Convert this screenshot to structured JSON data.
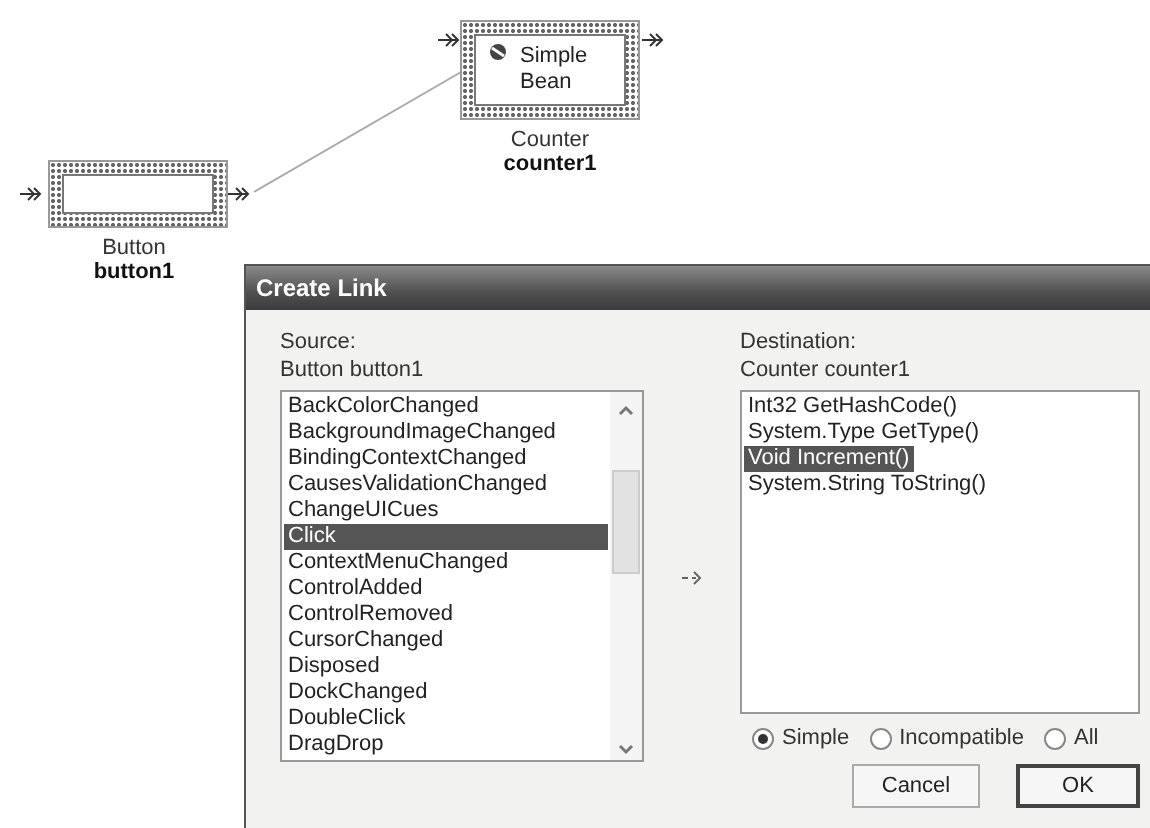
{
  "diagram": {
    "nodes": [
      {
        "kind": "bean",
        "body": "Simple Bean",
        "type_label": "Counter",
        "name": "counter1"
      },
      {
        "kind": "control",
        "type_label": "Button",
        "name": "button1"
      }
    ]
  },
  "dialog": {
    "title": "Create Link",
    "source": {
      "label": "Source:",
      "object": "Button button1",
      "items": [
        {
          "label": "BackColorChanged",
          "selected": false
        },
        {
          "label": "BackgroundImageChanged",
          "selected": false
        },
        {
          "label": "BindingContextChanged",
          "selected": false
        },
        {
          "label": "CausesValidationChanged",
          "selected": false
        },
        {
          "label": "ChangeUICues",
          "selected": false
        },
        {
          "label": "Click",
          "selected": true
        },
        {
          "label": "ContextMenuChanged",
          "selected": false
        },
        {
          "label": "ControlAdded",
          "selected": false
        },
        {
          "label": "ControlRemoved",
          "selected": false
        },
        {
          "label": "CursorChanged",
          "selected": false
        },
        {
          "label": "Disposed",
          "selected": false
        },
        {
          "label": "DockChanged",
          "selected": false
        },
        {
          "label": "DoubleClick",
          "selected": false
        },
        {
          "label": "DragDrop",
          "selected": false
        }
      ]
    },
    "destination": {
      "label": "Destination:",
      "object": "Counter counter1",
      "items": [
        {
          "label": "Int32 GetHashCode()",
          "selected": false
        },
        {
          "label": "System.Type GetType()",
          "selected": false
        },
        {
          "label": "Void Increment()",
          "selected": true
        },
        {
          "label": "System.String ToString()",
          "selected": false
        }
      ]
    },
    "filters": [
      {
        "label": "Simple",
        "selected": true
      },
      {
        "label": "Incompatible",
        "selected": false
      },
      {
        "label": "All",
        "selected": false
      }
    ],
    "buttons": [
      {
        "label": "Cancel",
        "default": false
      },
      {
        "label": "OK",
        "default": true
      }
    ]
  }
}
